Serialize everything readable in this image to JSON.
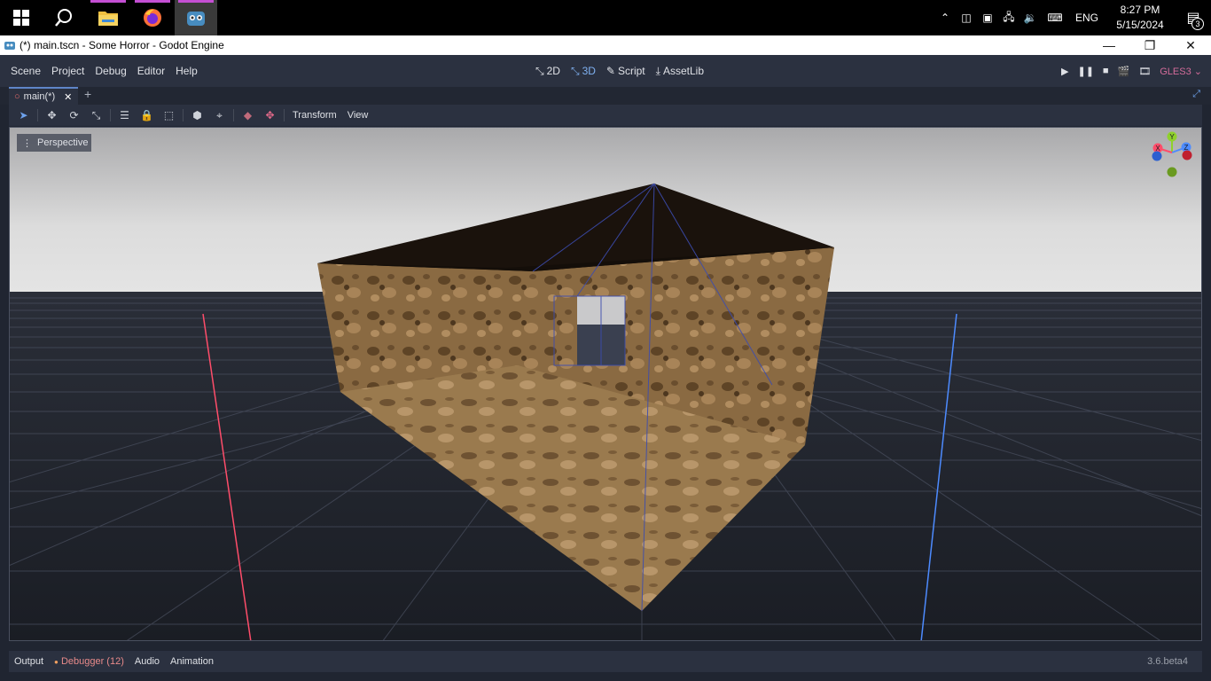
{
  "taskbar": {
    "apps": [
      {
        "name": "start",
        "icon": "windows-icon"
      },
      {
        "name": "search",
        "icon": "search-icon"
      },
      {
        "name": "file-explorer",
        "icon": "folder-icon"
      },
      {
        "name": "firefox",
        "icon": "firefox-icon"
      },
      {
        "name": "godot",
        "icon": "godot-icon"
      }
    ],
    "tray": {
      "language": "ENG",
      "time": "8:27 PM",
      "date": "5/15/2024",
      "notification_count": "3"
    }
  },
  "window": {
    "title": "(*) main.tscn - Some Horror - Godot Engine"
  },
  "menubar": {
    "items": [
      "Scene",
      "Project",
      "Debug",
      "Editor",
      "Help"
    ],
    "modes": [
      {
        "label": "2D",
        "icon": "2d-icon"
      },
      {
        "label": "3D",
        "icon": "3d-icon"
      },
      {
        "label": "Script",
        "icon": "script-icon"
      },
      {
        "label": "AssetLib",
        "icon": "assetlib-icon"
      }
    ],
    "active_mode": "3D",
    "renderer": "GLES3"
  },
  "scene_tabs": {
    "tabs": [
      {
        "label": "main(*)"
      }
    ]
  },
  "toolbar": {
    "transform_menu": "Transform",
    "view_menu": "View"
  },
  "viewport": {
    "projection_label": "Perspective",
    "gizmo_axes": [
      "Y",
      "X",
      "Z"
    ]
  },
  "bottom_panel": {
    "tabs": [
      {
        "label": "Output"
      },
      {
        "label": "Debugger (12)"
      },
      {
        "label": "Audio"
      },
      {
        "label": "Animation"
      }
    ],
    "version": "3.6.beta4"
  },
  "colors": {
    "editor_bg": "#202531",
    "panel_bg": "#2b3140",
    "accent": "#6ea3ee",
    "x_axis": "#ff4d6a",
    "z_axis": "#4d8bff",
    "y_axis": "#8fd12b",
    "wall_texture": "#8a6a42"
  }
}
